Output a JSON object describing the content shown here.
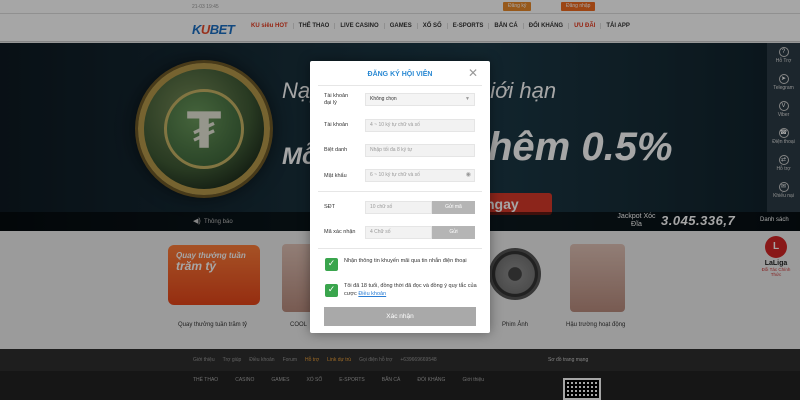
{
  "topbar": {
    "time": "21-03 19:45",
    "register": "Đăng ký",
    "login": "Đăng nhập"
  },
  "nav": {
    "logo_a": "K",
    "logo_u": "U",
    "logo_b": "BET",
    "items": [
      "KU siêu HOT",
      "THỂ THAO",
      "LIVE CASINO",
      "GAMES",
      "XỔ SỐ",
      "E-SPORTS",
      "BẮN CÁ",
      "ĐỔI KHÁNG",
      "ƯU ĐÃI",
      "TẢI APP"
    ]
  },
  "banner": {
    "line1a": "Nạp",
    "line1b": "giới hạn",
    "line2": "Mỗ",
    "pct": "hêm 0.5%",
    "cta": "ngay",
    "marquee": "Thông báo",
    "jackpot_label": "Jackpot Xóc Đĩa",
    "jackpot_value": "3.045.336,7",
    "side_link": "Danh sách"
  },
  "sidebar": {
    "items": [
      "Hỗ Trợ",
      "Telegram",
      "Viber",
      "Điện thoại",
      "Hỗ trợ",
      "Khiếu nại"
    ]
  },
  "promos": {
    "card_line1": "Quay thưởng tuần",
    "card_line2": "trăm tỷ",
    "labels": [
      "Quay thưởng tuần trăm tỷ",
      "COOL",
      "Phim Ảnh",
      "Hậu trường hoạt động"
    ],
    "laliga_mark": "L",
    "laliga": "LaLiga",
    "laliga_sub": "Đối Tác Chính Thức"
  },
  "footer": {
    "links": [
      "Giới thiệu",
      "Trợ giúp",
      "Điều khoản",
      "Forum",
      "Hỗ trợ",
      "Link dự trù",
      "Gọi điện hỗ trợ",
      "+639669669548"
    ],
    "sitemap": "Sơ đồ trang mạng",
    "cats": [
      "THỂ THAO",
      "CASINO",
      "GAMES",
      "XỔ SỐ",
      "E-SPORTS",
      "BẮN CÁ",
      "ĐỔI KHÁNG",
      "Giới thiệu"
    ]
  },
  "modal": {
    "title": "ĐĂNG KÝ HỘI VIÊN",
    "close": "✕",
    "agent_label_1": "Tài khoản",
    "agent_label_2": "đại lý",
    "agent_value": "Không chọn",
    "account_label": "Tài khoản",
    "account_placeholder": "4 ~ 10 ký tự chữ và số",
    "nickname_label": "Biệt danh",
    "nickname_placeholder": "Nhập tối đa 8 ký tự",
    "password_label": "Mật khẩu",
    "password_placeholder": "6 ~ 10 ký tự chữ và số",
    "phone_label": "SĐT",
    "phone_placeholder": "10 chữ số",
    "send_code": "Gửi mã",
    "code_label": "Mã xác nhận",
    "code_placeholder": "4 Chữ số",
    "send": "Gửi",
    "opt_promo": "Nhận thông tin khuyến mãi qua tin nhắn điện thoại",
    "opt_terms": "Tôi đã 18 tuổi, đồng thời đã đọc và đồng ý quy tắc của cược",
    "terms_link": "Điều khoản",
    "submit": "Xác nhận"
  }
}
